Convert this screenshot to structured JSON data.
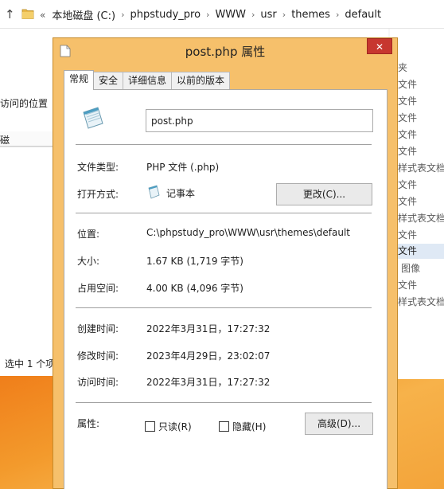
{
  "explorer": {
    "breadcrumb_chevron": "«",
    "breadcrumb": [
      "本地磁盘 (C:)",
      "phpstudy_pro",
      "WWW",
      "usr",
      "themes",
      "default"
    ],
    "left_pane": {
      "recent_location": "访问的位置",
      "cut_item": "磁",
      "status": "选中 1 个项"
    },
    "right_column": {
      "header": "夹",
      "items": [
        "文件",
        "文件",
        "文件",
        "文件",
        "文件",
        "样式表文档",
        "文件",
        "文件",
        "样式表文档",
        "文件",
        "文件",
        "图像",
        "文件",
        "样式表文档"
      ],
      "selected_index": 10
    }
  },
  "dialog": {
    "title": "post.php 属性",
    "close_glyph": "✕",
    "tabs": [
      "常规",
      "安全",
      "详细信息",
      "以前的版本"
    ],
    "active_tab": 0,
    "file_name": "post.php",
    "fields": {
      "file_type_label": "文件类型:",
      "file_type_value": "PHP 文件 (.php)",
      "opens_with_label": "打开方式:",
      "opens_with_value": "记事本",
      "change_button": "更改(C)...",
      "location_label": "位置:",
      "location_value": "C:\\phpstudy_pro\\WWW\\usr\\themes\\default",
      "size_label": "大小:",
      "size_value": "1.67 KB (1,719 字节)",
      "size_on_disk_label": "占用空间:",
      "size_on_disk_value": "4.00 KB (4,096 字节)",
      "created_label": "创建时间:",
      "created_value": "2022年3月31日，17:27:32",
      "modified_label": "修改时间:",
      "modified_value": "2023年4月29日，23:02:07",
      "accessed_label": "访问时间:",
      "accessed_value": "2022年3月31日，17:27:32",
      "attributes_label": "属性:",
      "readonly_label": "只读(R)",
      "readonly_checked": false,
      "hidden_label": "隐藏(H)",
      "hidden_checked": false,
      "advanced_button": "高级(D)..."
    }
  },
  "colors": {
    "dialog_frame": "#f6c06b",
    "close_button": "#c7372f",
    "desktop": "#f39a2c",
    "selection": "#dfe9f5"
  }
}
